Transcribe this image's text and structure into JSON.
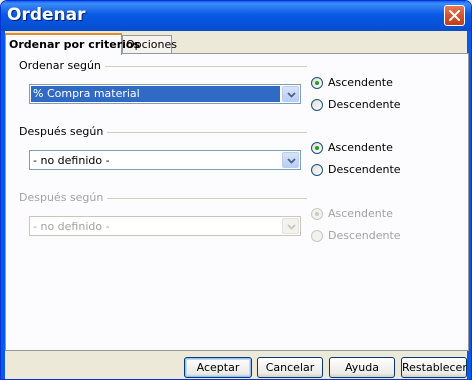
{
  "window": {
    "title": "Ordenar"
  },
  "tabs": [
    {
      "label": "Ordenar por criterios",
      "active": true
    },
    {
      "label": "Opciones",
      "active": false
    }
  ],
  "sections": [
    {
      "label": "Ordenar según",
      "value": "% Compra material",
      "enabled": true,
      "ascending_label": "Ascendente",
      "descending_label": "Descendente",
      "selected": "ascending"
    },
    {
      "label": "Después según",
      "value": "- no definido -",
      "enabled": true,
      "ascending_label": "Ascendente",
      "descending_label": "Descendente",
      "selected": "ascending"
    },
    {
      "label": "Después según",
      "value": "- no definido -",
      "enabled": false,
      "ascending_label": "Ascendente",
      "descending_label": "Descendente",
      "selected": "ascending"
    }
  ],
  "buttons": {
    "ok": "Aceptar",
    "cancel": "Cancelar",
    "help": "Ayuda",
    "reset": "Restablecer"
  },
  "colors": {
    "titlebar": "#0a5ae4",
    "selection": "#316ac5",
    "active_tab_accent": "#e68b2c",
    "radio_dot": "#21a121"
  }
}
